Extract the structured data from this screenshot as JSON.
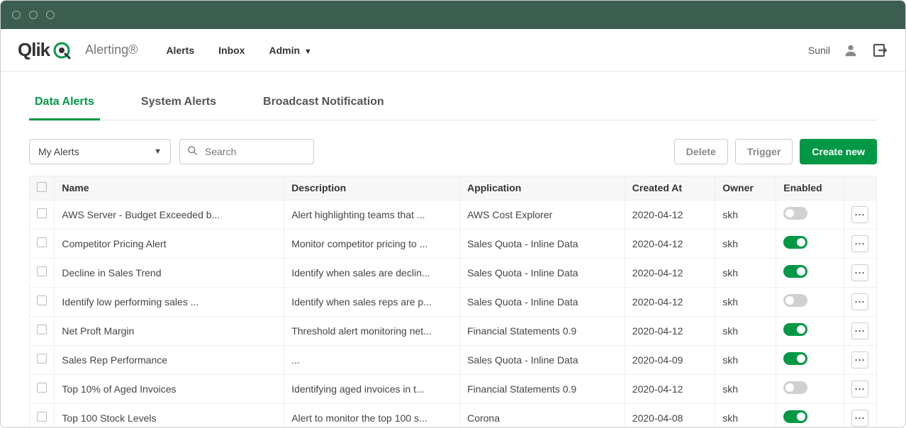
{
  "brand": {
    "logo_text": "Qlik",
    "product": "Alerting®"
  },
  "nav": {
    "alerts": "Alerts",
    "inbox": "Inbox",
    "admin": "Admin"
  },
  "user": {
    "name": "Sunil"
  },
  "tabs": {
    "data_alerts": "Data Alerts",
    "system_alerts": "System Alerts",
    "broadcast": "Broadcast Notification"
  },
  "toolbar": {
    "filter_dropdown": "My Alerts",
    "search_placeholder": "Search",
    "delete": "Delete",
    "trigger": "Trigger",
    "create_new": "Create new"
  },
  "columns": {
    "name": "Name",
    "description": "Description",
    "application": "Application",
    "created_at": "Created At",
    "owner": "Owner",
    "enabled": "Enabled"
  },
  "rows": [
    {
      "name": "AWS Server - Budget Exceeded b...",
      "description": "Alert highlighting teams that ...",
      "application": "AWS Cost Explorer",
      "created_at": "2020-04-12",
      "owner": "skh",
      "enabled": false
    },
    {
      "name": "Competitor Pricing Alert",
      "description": "Monitor competitor pricing to ...",
      "application": "Sales Quota - Inline Data",
      "created_at": "2020-04-12",
      "owner": "skh",
      "enabled": true
    },
    {
      "name": "Decline in Sales Trend",
      "description": "Identify when sales are declin...",
      "application": "Sales Quota - Inline Data",
      "created_at": "2020-04-12",
      "owner": "skh",
      "enabled": true
    },
    {
      "name": "Identify low performing sales ...",
      "description": "Identify when sales reps are p...",
      "application": "Sales Quota - Inline Data",
      "created_at": "2020-04-12",
      "owner": "skh",
      "enabled": false
    },
    {
      "name": "Net Proft Margin",
      "description": "Threshold alert monitoring net...",
      "application": "Financial Statements 0.9",
      "created_at": "2020-04-12",
      "owner": "skh",
      "enabled": true
    },
    {
      "name": "Sales Rep Performance",
      "description": "...",
      "application": "Sales Quota - Inline Data",
      "created_at": "2020-04-09",
      "owner": "skh",
      "enabled": true
    },
    {
      "name": "Top 10% of Aged Invoices",
      "description": "Identifying aged invoices in t...",
      "application": "Financial Statements 0.9",
      "created_at": "2020-04-12",
      "owner": "skh",
      "enabled": false
    },
    {
      "name": "Top 100 Stock Levels",
      "description": "Alert to monitor the top 100 s...",
      "application": "Corona",
      "created_at": "2020-04-08",
      "owner": "skh",
      "enabled": true
    }
  ]
}
